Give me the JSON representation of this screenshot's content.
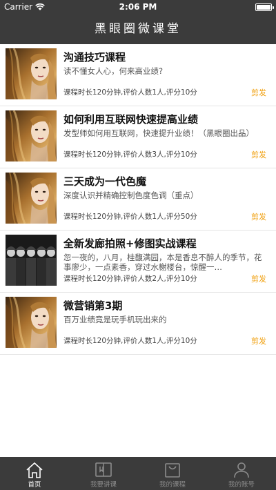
{
  "status_bar": {
    "carrier": "Carrier",
    "time": "2:06 PM"
  },
  "nav": {
    "title": "黑眼圈微课堂"
  },
  "courses": [
    {
      "title": "沟通技巧课程",
      "desc": "读不懂女人心，何来高业绩?",
      "meta": "课程时长120分钟,评价人数1人,评分10分",
      "tag": "剪发",
      "thumb": "hair"
    },
    {
      "title": "如何利用互联网快速提高业绩",
      "desc": "发型师如何用互联网，快速提升业绩！（黑眼圈出品）",
      "meta": "课程时长120分钟,评价人数3人,评分10分",
      "tag": "剪发",
      "thumb": "hair"
    },
    {
      "title": "三天成为一代色魔",
      "desc": "深度认识并精确控制色度色调（重点）",
      "meta": "课程时长120分钟,评价人数1人,评分50分",
      "tag": "剪发",
      "thumb": "hair"
    },
    {
      "title": "全新发廊拍照+修图实战课程",
      "desc": "忽一夜的，八月，桂馥满园，本是香息不醉人的季节，花事廖少，一点素香，穿过水榭楼台，惊醒一…",
      "meta": "课程时长120分钟,评价人数2人,评分10分",
      "tag": "剪发",
      "thumb": "group"
    },
    {
      "title": "微营销第3期",
      "desc": "百万业绩竟是玩手机玩出来的",
      "meta": "课程时长120分钟,评价人数1人,评分10分",
      "tag": "剪发",
      "thumb": "hair"
    }
  ],
  "tabs": [
    {
      "label": "首页",
      "icon": "home-icon",
      "active": true
    },
    {
      "label": "我要讲课",
      "icon": "book-icon",
      "active": false
    },
    {
      "label": "我的课程",
      "icon": "bag-icon",
      "active": false
    },
    {
      "label": "我的账号",
      "icon": "user-icon",
      "active": false
    }
  ],
  "colors": {
    "bar": "#3b3b3b",
    "tag": "#f0a010",
    "divider": "#e3e3e3"
  }
}
